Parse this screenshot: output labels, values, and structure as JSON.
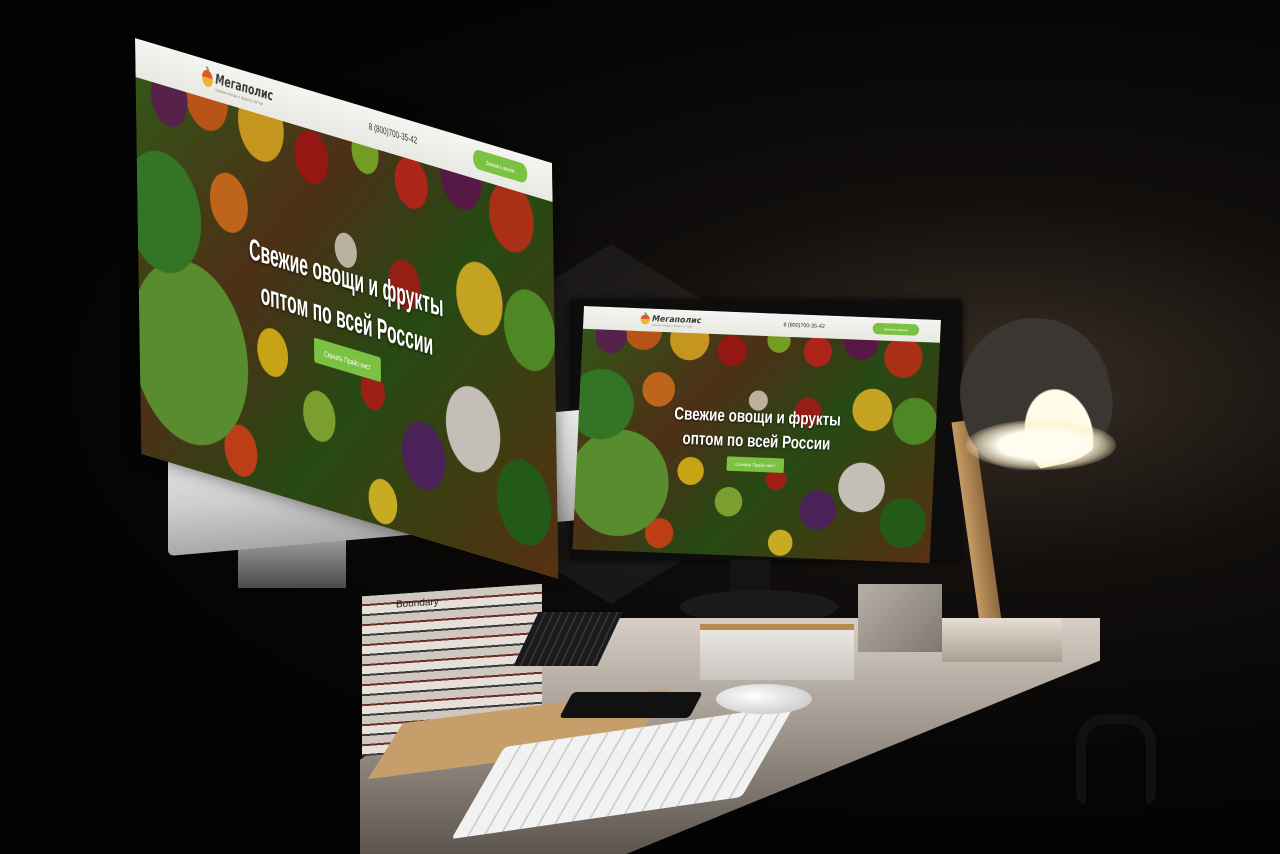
{
  "site": {
    "logo_name": "Мегаполис",
    "logo_tagline": "свежие овощи и фрукты оптом",
    "phone": "8 (800)700-35-42",
    "header_button": "Заказать звонок",
    "hero_line1": "Свежие овощи и фрукты",
    "hero_line2": "оптом по всей России",
    "hero_button": "Скачать Прайс-лист"
  },
  "scene": {
    "books_label": "Boundary",
    "computer_logo": ""
  },
  "colors": {
    "accent_green": "#7cc242",
    "header_bg": "#f0f0ec",
    "background": "#050505"
  },
  "icons": {
    "logo": "apple-fruit-logo-icon",
    "computer": "apple-logo-icon"
  }
}
